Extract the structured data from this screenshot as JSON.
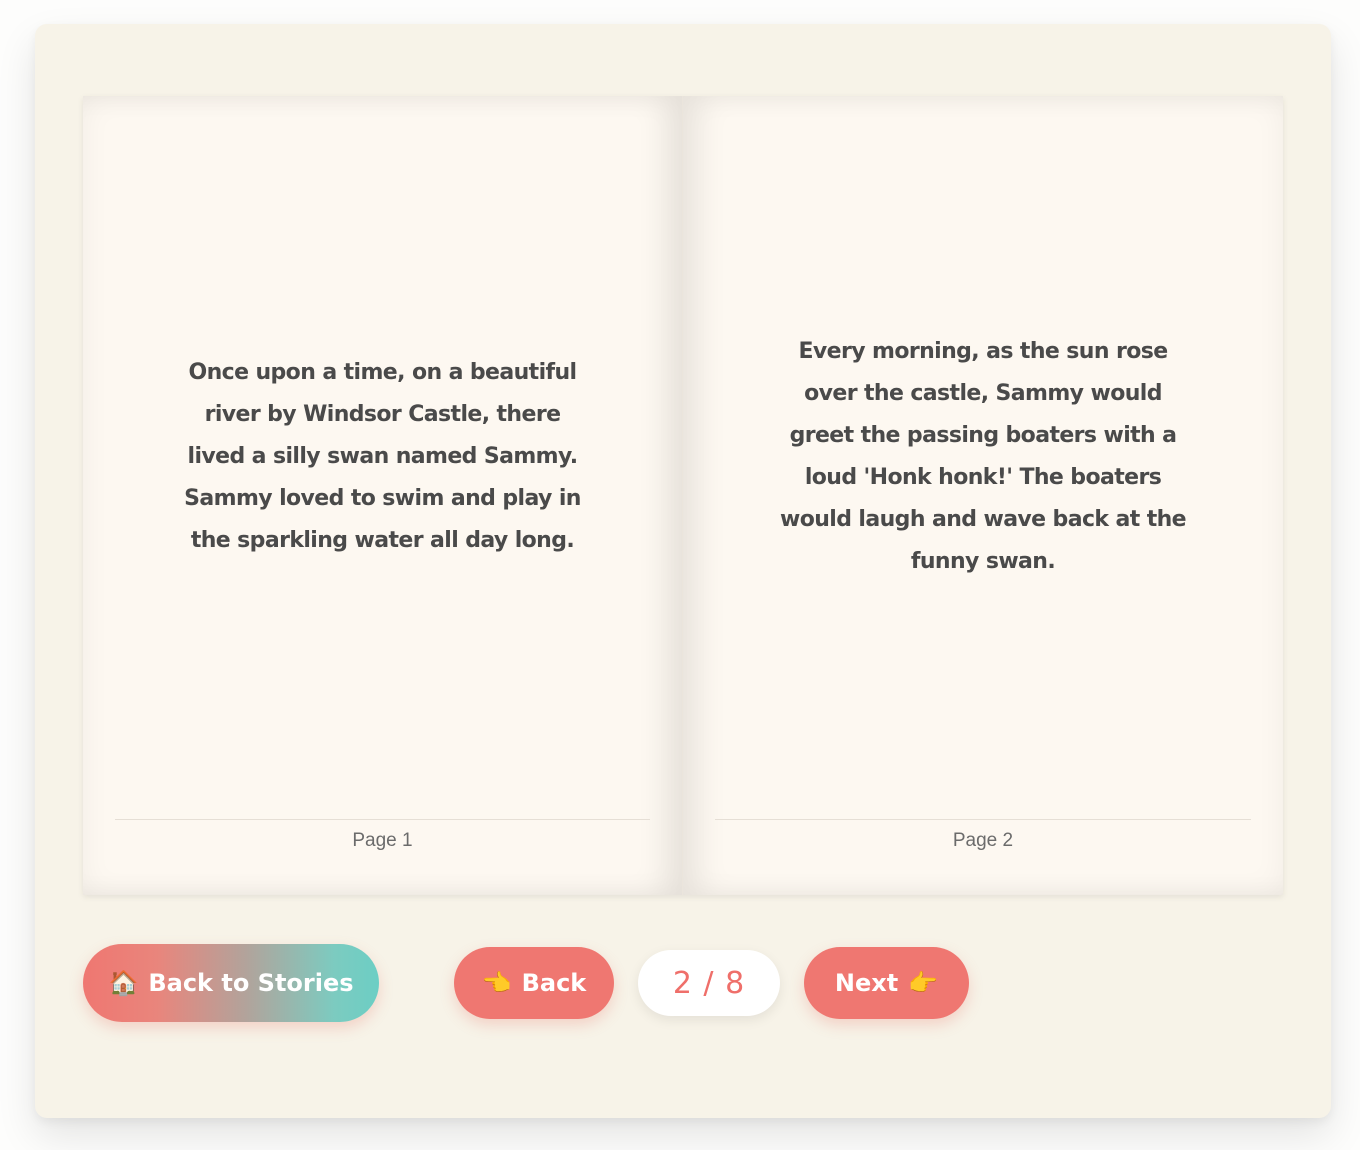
{
  "book": {
    "left_page": {
      "text": "Once upon a time, on a beautiful river by Windsor Castle, there lived a silly swan named Sammy. Sammy loved to swim and play in the sparkling water all day long.",
      "footer": "Page 1"
    },
    "right_page": {
      "text": "Every morning, as the sun rose over the castle, Sammy would greet the passing boaters with a loud 'Honk honk!' The boaters would laugh and wave back at the funny swan.",
      "footer": "Page 2"
    }
  },
  "controls": {
    "stories_label": "Back to Stories",
    "stories_icon": "🏠",
    "back_label": "Back",
    "back_icon": "👈",
    "next_label": "Next",
    "next_icon": "👉",
    "counter": "2 / 8"
  },
  "colors": {
    "button": "#ef7771",
    "gradient_end": "#6ccec4",
    "counter_text": "#ef6f6a",
    "background": "#f7f3e8",
    "page": "#fdf8f1"
  }
}
